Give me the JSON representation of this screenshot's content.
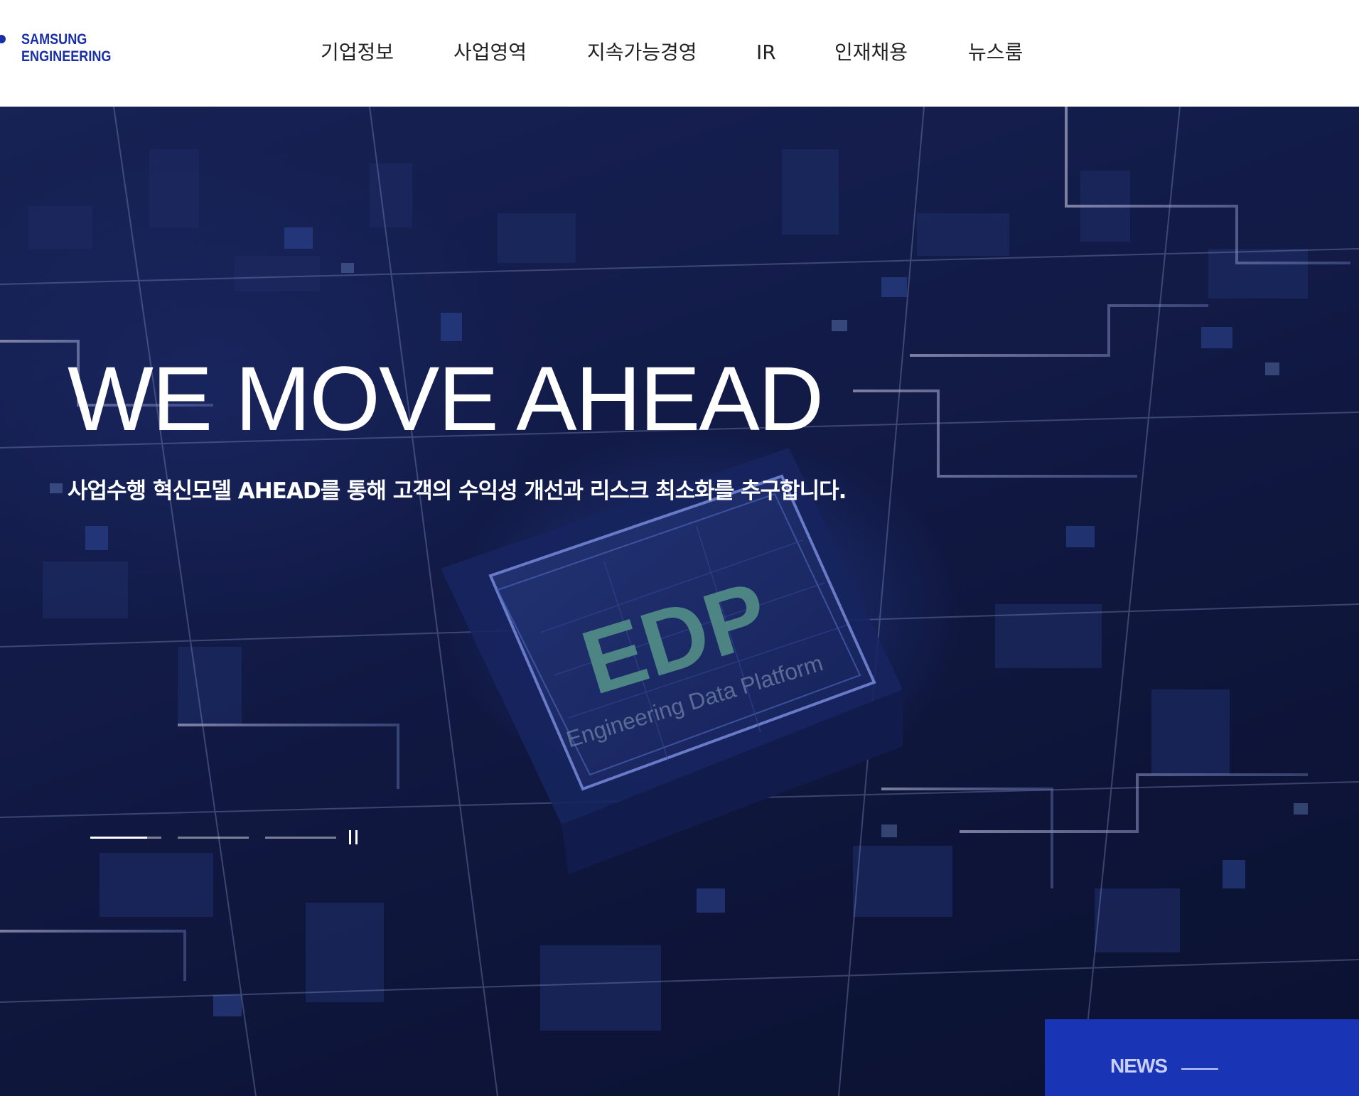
{
  "brand": {
    "line1": "SAMSUNG",
    "line2": "ENGINEERING",
    "color": "#1a2fa8"
  },
  "nav": {
    "items": [
      {
        "label": "기업정보"
      },
      {
        "label": "사업영역"
      },
      {
        "label": "지속가능경영"
      },
      {
        "label": "IR"
      },
      {
        "label": "인재채용"
      },
      {
        "label": "뉴스룸"
      }
    ]
  },
  "hero": {
    "title": "WE MOVE AHEAD",
    "subtitle": "사업수행 혁신모델 AHEAD를 통해 고객의 수익성 개선과 리스크 최소화를 추구합니다.",
    "image_text": {
      "main": "EDP",
      "caption": "Engineering Data Platform"
    },
    "slides": {
      "count": 3,
      "progress": [
        0.8,
        0,
        0
      ]
    },
    "pause_icon": "pause-icon"
  },
  "news": {
    "label": "NEWS",
    "background": "#1934b4"
  }
}
